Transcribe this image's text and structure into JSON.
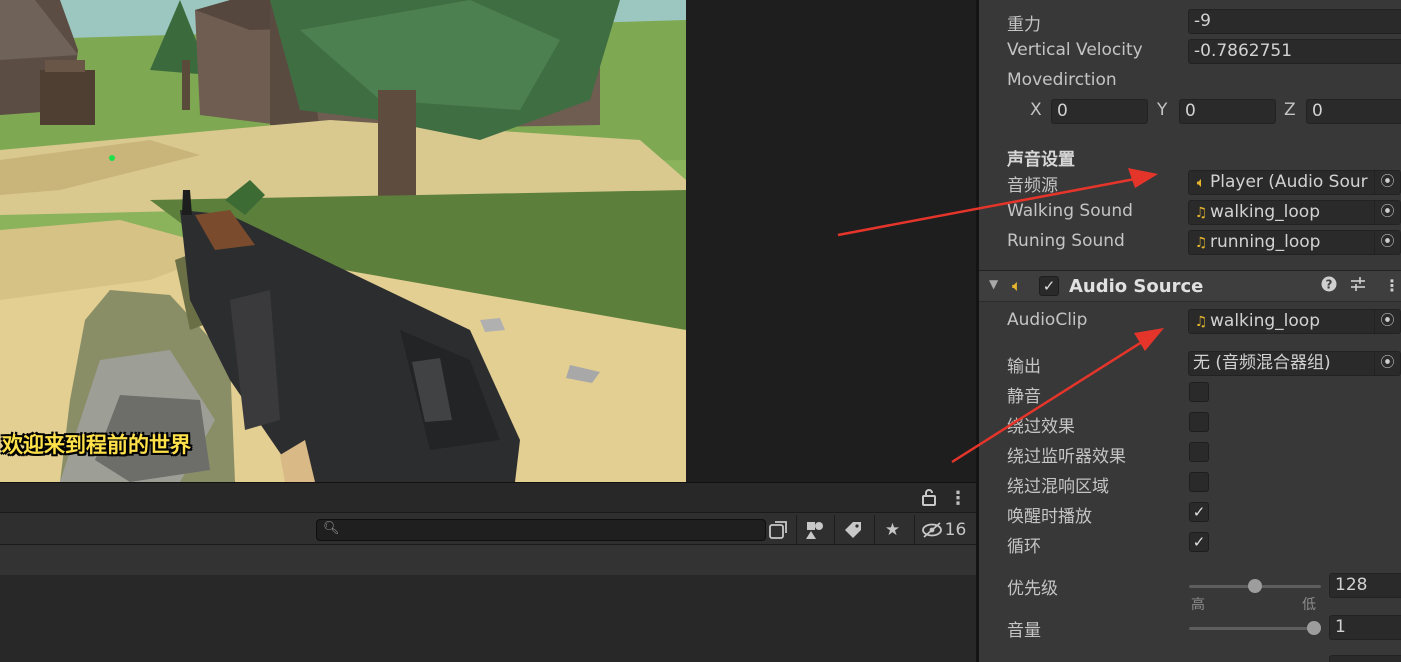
{
  "game_view": {
    "caption": "欢迎来到程前的世界"
  },
  "bottom_panel": {
    "search": {
      "value": "",
      "placeholder": ""
    },
    "hidden_count": "16"
  },
  "inspector": {
    "partial_top_label": "",
    "gravity": {
      "label": "重力",
      "value": "-9"
    },
    "vertical_velocity": {
      "label": "Vertical Velocity",
      "value": "-0.7862751"
    },
    "move_direction": {
      "label": "Movedirction",
      "x_label": "X",
      "x": "0",
      "y_label": "Y",
      "y": "0",
      "z_label": "Z",
      "z": "0"
    },
    "sound_settings": {
      "header": "声音设置",
      "audio_source": {
        "label": "音频源",
        "value": "Player (Audio Sour"
      },
      "walking_sound": {
        "label": "Walking Sound",
        "value": "walking_loop"
      },
      "running_sound": {
        "label": "Runing Sound",
        "value": "running_loop"
      }
    },
    "audio_source_component": {
      "title": "Audio Source",
      "enabled": true,
      "audio_clip": {
        "label": "AudioClip",
        "value": "walking_loop"
      },
      "output": {
        "label": "输出",
        "value": "无 (音频混合器组)"
      },
      "mute": {
        "label": "静音",
        "checked": false
      },
      "bypass_effects": {
        "label": "绕过效果",
        "checked": false
      },
      "bypass_listener_effects": {
        "label": "绕过监听器效果",
        "checked": false
      },
      "bypass_reverb_zones": {
        "label": "绕过混响区域",
        "checked": false
      },
      "play_on_awake": {
        "label": "唤醒时播放",
        "checked": true
      },
      "loop": {
        "label": "循环",
        "checked": true
      },
      "priority": {
        "label": "优先级",
        "value": "128",
        "min_label": "高",
        "max_label": "低",
        "level": 0.5
      },
      "volume": {
        "label": "音量",
        "value": "1",
        "level": 1.0
      }
    }
  },
  "icons": {
    "audio": "speaker-icon",
    "clip": "music-note-icon",
    "picker": "object-picker-icon"
  },
  "colors": {
    "arrow": "#e5352b",
    "caption": "#ffe14a",
    "audio_icon": "#e6b52e"
  }
}
